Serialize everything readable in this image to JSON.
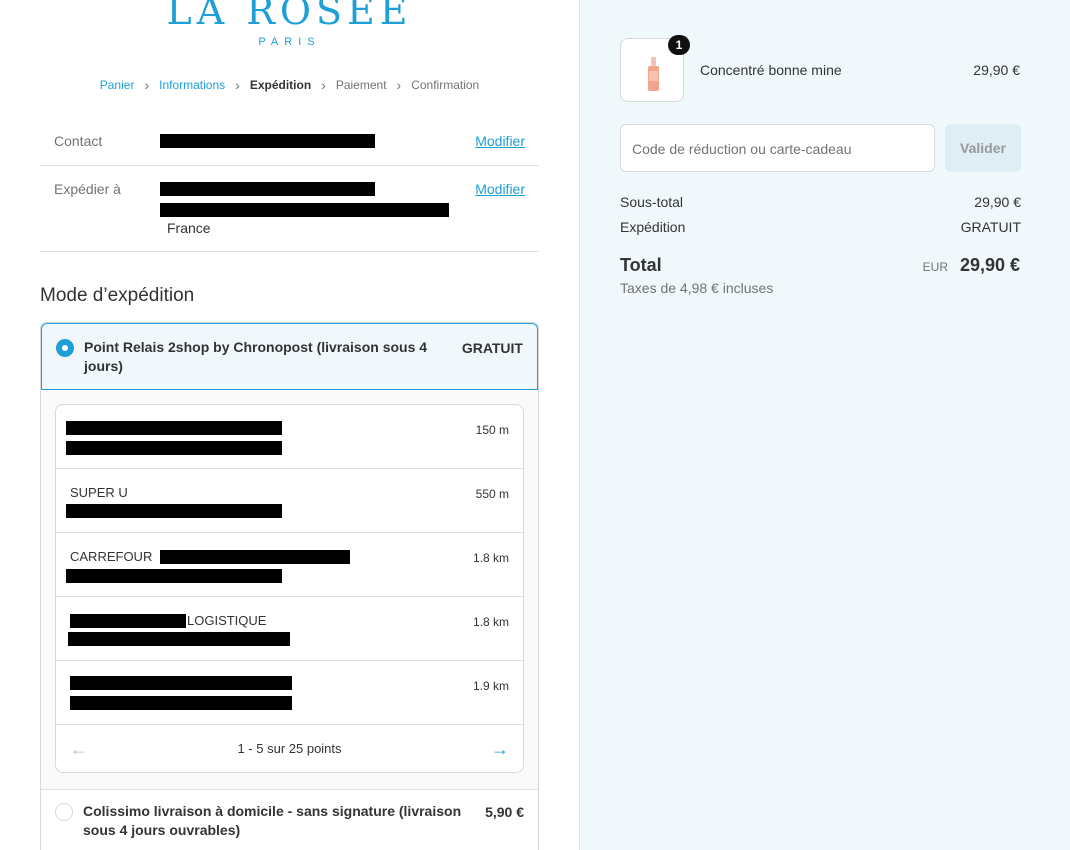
{
  "brand": {
    "name": "LA ROSÉE",
    "city": "PARIS"
  },
  "breadcrumb": [
    "Panier",
    "Informations",
    "Expédition",
    "Paiement",
    "Confirmation"
  ],
  "contact": {
    "label": "Contact",
    "action": "Modifier"
  },
  "ship_to": {
    "label": "Expédier à",
    "action": "Modifier",
    "country": "France"
  },
  "shipping": {
    "title": "Mode d’expédition",
    "option1": {
      "label": "Point Relais 2shop by Chronopost (livraison sous 4 jours)",
      "price": "GRATUIT"
    },
    "relays": [
      {
        "name": "",
        "distance": "150 m"
      },
      {
        "name": "SUPER U",
        "distance": "550 m"
      },
      {
        "name": "CARREFOUR ",
        "distance": "1.8 km"
      },
      {
        "name": "LOGISTIQUE",
        "distance": "1.8 km"
      },
      {
        "name": "",
        "distance": "1.9 km"
      }
    ],
    "pager": "1 - 5 sur 25 points",
    "option2": {
      "label": "Colissimo livraison à domicile - sans signature (livraison sous 4 jours ouvrables)",
      "price": "5,90 €"
    }
  },
  "summary": {
    "quantity": "1",
    "product_name": "Concentré bonne mine",
    "product_price": "29,90 €",
    "discount_placeholder": "Code de réduction ou carte-cadeau",
    "validate_label": "Valider",
    "subtotal_label": "Sous-total",
    "subtotal_value": "29,90 €",
    "shipping_label": "Expédition",
    "shipping_value": "GRATUIT",
    "total_label": "Total",
    "total_currency": "EUR",
    "total_value": "29,90 €",
    "taxes": "Taxes de 4,98 € incluses"
  },
  "colors": {
    "accent": "#1f9fd8",
    "panel": "#f1f8fb"
  }
}
